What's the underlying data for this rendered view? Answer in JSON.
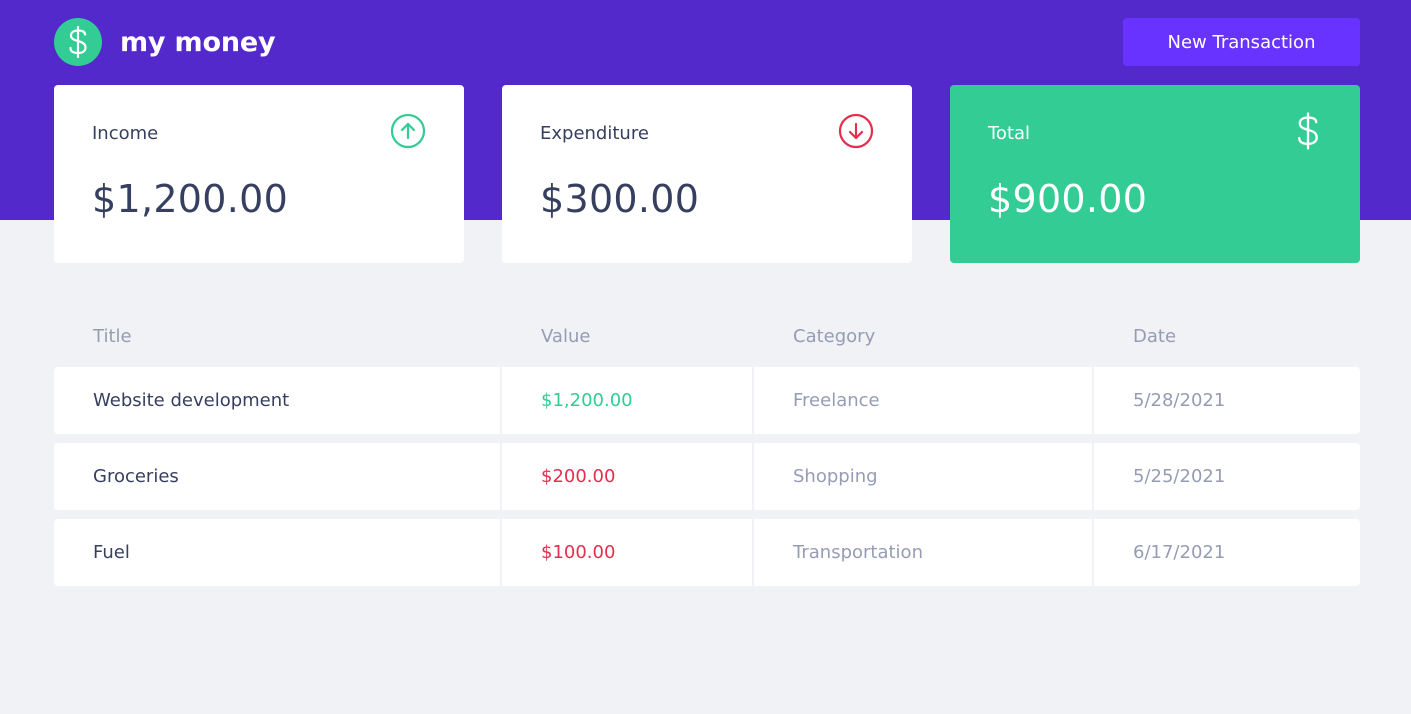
{
  "header": {
    "logo_icon": "dollar-icon",
    "app_name": "my money",
    "new_transaction_label": "New Transaction"
  },
  "summary": {
    "income": {
      "title": "Income",
      "value": "$1,200.00",
      "icon": "arrow-up-circle-icon",
      "icon_color": "#33CC95"
    },
    "expenditure": {
      "title": "Expenditure",
      "value": "$300.00",
      "icon": "arrow-down-circle-icon",
      "icon_color": "#E52E4D"
    },
    "total": {
      "title": "Total",
      "value": "$900.00",
      "icon": "dollar-icon",
      "background": "#33CC95"
    }
  },
  "table": {
    "headers": [
      "Title",
      "Value",
      "Category",
      "Date"
    ],
    "rows": [
      {
        "title": "Website development",
        "value": "$1,200.00",
        "type": "income",
        "category": "Freelance",
        "date": "5/28/2021"
      },
      {
        "title": "Groceries",
        "value": "$200.00",
        "type": "outcome",
        "category": "Shopping",
        "date": "5/25/2021"
      },
      {
        "title": "Fuel",
        "value": "$100.00",
        "type": "outcome",
        "category": "Transportation",
        "date": "6/17/2021"
      }
    ]
  },
  "colors": {
    "header_bg": "#5429CC",
    "button_bg": "#6933FF",
    "green": "#33CC95",
    "red": "#E52E4D",
    "page_bg": "#F0F2F5",
    "text_title": "#363F5F",
    "text_body": "#969CB3"
  }
}
